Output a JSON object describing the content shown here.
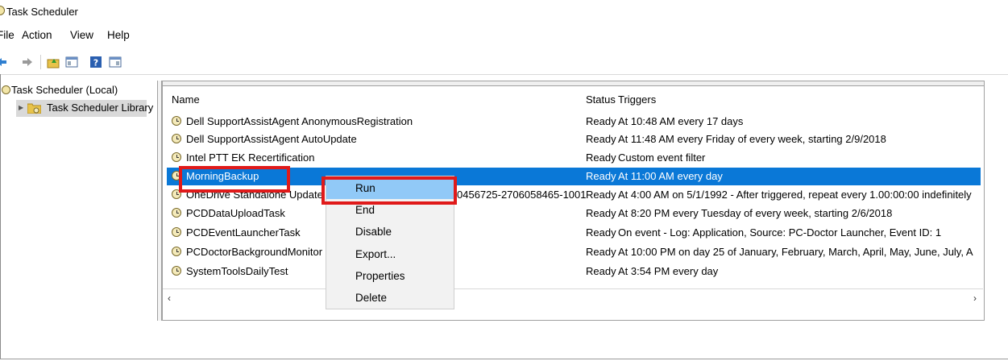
{
  "window": {
    "title": "Task Scheduler"
  },
  "menu": [
    {
      "label": "File",
      "name": "menu-file"
    },
    {
      "label": "Action",
      "name": "menu-action"
    },
    {
      "label": "View",
      "name": "menu-view"
    },
    {
      "label": "Help",
      "name": "menu-help"
    }
  ],
  "toolbar": {
    "icons": [
      "back-arrow-icon",
      "forward-arrow-icon",
      "up-folder-icon",
      "show-hide-console-tree-icon",
      "help-icon",
      "show-hide-action-pane-icon"
    ]
  },
  "tree": {
    "root": "Task Scheduler (Local)",
    "library": "Task Scheduler Library"
  },
  "table": {
    "columns": {
      "name": "Name",
      "status": "Status",
      "triggers": "Triggers"
    },
    "rows": [
      {
        "name": "Dell SupportAssistAgent AnonymousRegistration",
        "status": "Ready",
        "trigger": "At 10:48 AM every 17 days"
      },
      {
        "name": "Dell SupportAssistAgent AutoUpdate",
        "status": "Ready",
        "trigger": "At 11:48 AM every Friday of every week, starting 2/9/2018"
      },
      {
        "name": "Intel PTT EK Recertification",
        "status": "Ready",
        "trigger": "Custom event filter"
      },
      {
        "name": "MorningBackup",
        "status": "Ready",
        "trigger": "At 11:00 AM every day",
        "selected": true
      },
      {
        "name": "OneDrive Standalone Update",
        "name_tail": "0456725-2706058465-1001",
        "status": "Ready",
        "trigger": "At 4:00 AM on 5/1/1992 - After triggered, repeat every 1.00:00:00 indefinitely"
      },
      {
        "name": "PCDDataUploadTask",
        "status": "Ready",
        "trigger": "At 8:20 PM every Tuesday of every week, starting 2/6/2018"
      },
      {
        "name": "PCDEventLauncherTask",
        "status": "Ready",
        "trigger": "On event - Log: Application, Source: PC-Doctor Launcher, Event ID: 1"
      },
      {
        "name": "PCDoctorBackgroundMonitor",
        "status": "Ready",
        "trigger": "At 10:00 PM  on day 25 of January, February, March, April, May, June, July, A"
      },
      {
        "name": "SystemToolsDailyTest",
        "status": "Ready",
        "trigger": "At 3:54 PM every day"
      }
    ]
  },
  "context_menu": {
    "items": [
      {
        "label": "Run",
        "highlighted": true
      },
      {
        "label": "End"
      },
      {
        "label": "Disable"
      },
      {
        "label": "Export..."
      },
      {
        "label": "Properties"
      },
      {
        "label": "Delete"
      }
    ]
  },
  "annotations": {
    "highlight_color": "#e01a1a"
  },
  "colors": {
    "selection": "#0a78d7",
    "menu_hover": "#91c9f7"
  }
}
